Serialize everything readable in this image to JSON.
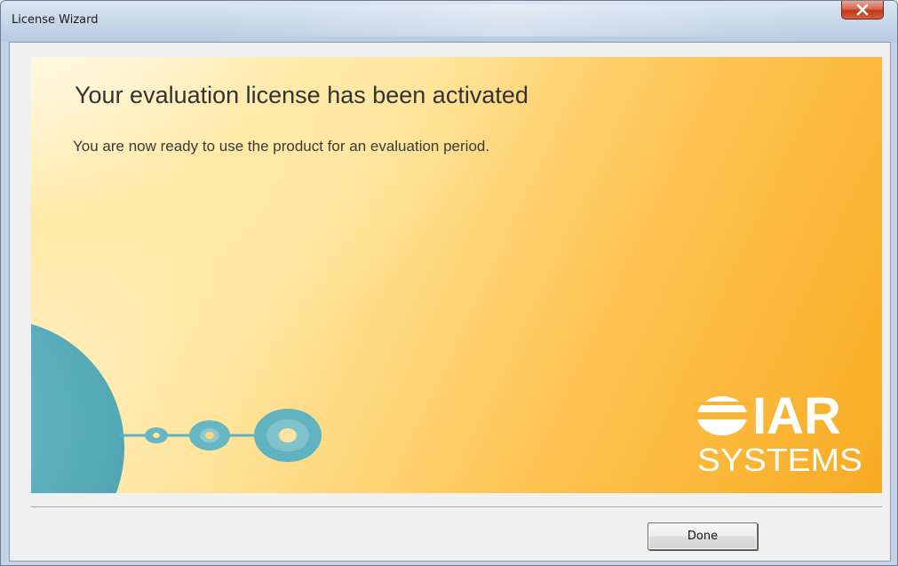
{
  "window": {
    "title": "License Wizard",
    "close_icon": "close-icon"
  },
  "banner": {
    "heading": "Your evaluation license has been activated",
    "subtext": "You are now ready to use the product for an evaluation period."
  },
  "logo": {
    "line1": "IAR",
    "line2": "SYSTEMS",
    "icon": "iar-systems-logo"
  },
  "buttons": {
    "done_label": "Done"
  },
  "colors": {
    "banner_light": "#fff8dc",
    "banner_dark": "#f8ab22",
    "disc_teal": "#5fb3c0",
    "logo_white": "#ffffff",
    "text_dark": "#333333"
  }
}
